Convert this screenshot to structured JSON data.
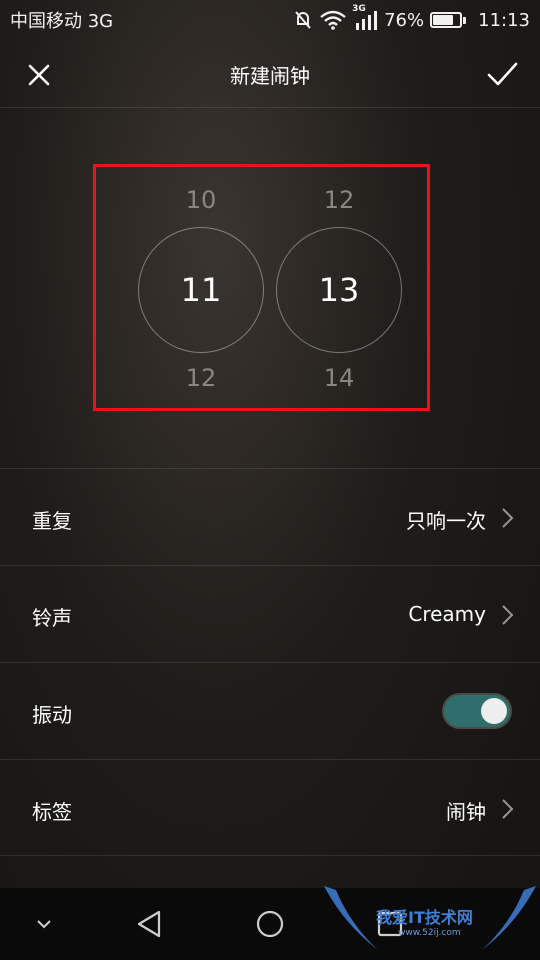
{
  "statusbar": {
    "carrier": "中国移动 3G",
    "network_badge": "3G",
    "battery": "76%",
    "battery_level": 0.76,
    "time": "11:13",
    "icons": [
      "mute-icon",
      "wifi-icon",
      "signal-icon",
      "battery-icon"
    ]
  },
  "header": {
    "title": "新建闹钟",
    "close_icon": "close-icon",
    "confirm_icon": "check-icon"
  },
  "time_picker": {
    "hour": {
      "prev": "10",
      "current": "11",
      "next": "12"
    },
    "minute": {
      "prev": "12",
      "current": "13",
      "next": "14"
    },
    "highlight_color": "#e8141a"
  },
  "settings": [
    {
      "label": "重复",
      "value": "只响一次"
    },
    {
      "label": "铃声",
      "value": "Creamy"
    },
    {
      "label": "振动",
      "toggle_on": true
    },
    {
      "label": "标签",
      "value": "闹钟"
    }
  ],
  "navbar": {
    "icons": [
      "chevron-down-icon",
      "back-icon",
      "home-icon",
      "recent-apps-icon"
    ]
  },
  "watermark": {
    "text": "我爱IT技术网",
    "url": "www.52ij.com"
  },
  "colors": {
    "toggle_on": "#2f6e6b",
    "background": "#1f1c19"
  }
}
